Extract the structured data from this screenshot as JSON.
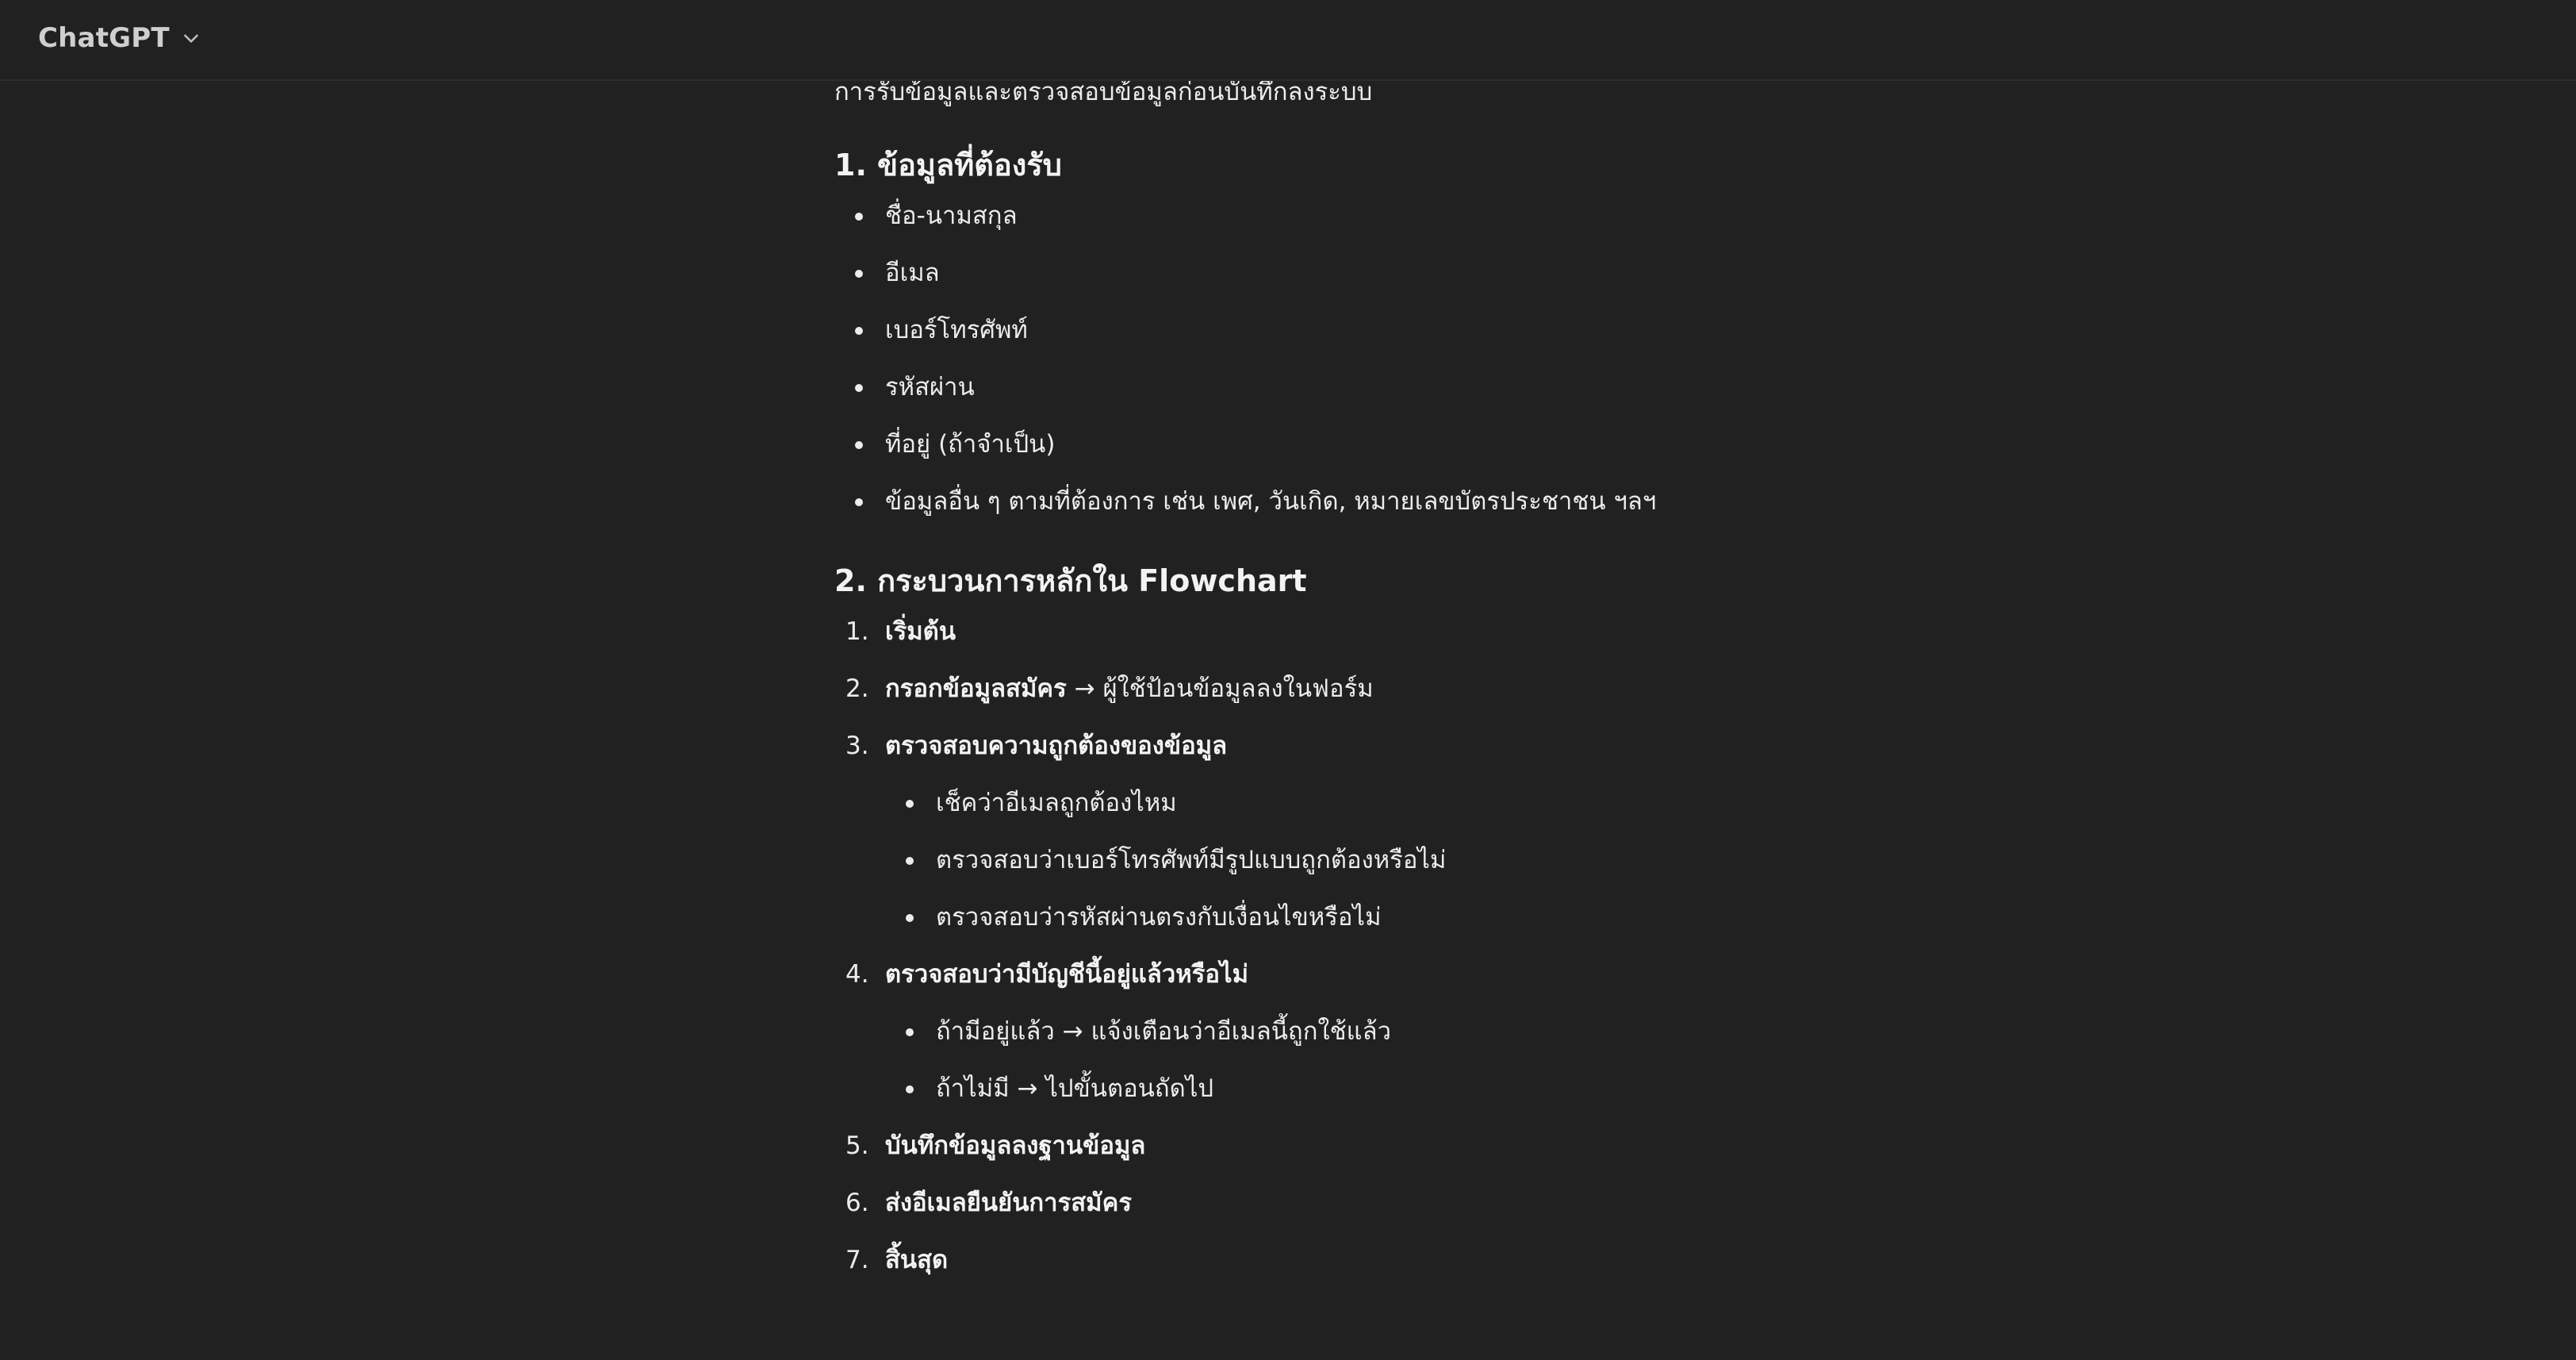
{
  "app": {
    "title": "ChatGPT"
  },
  "message": {
    "intro": "การรับข้อมูลและตรวจสอบข้อมูลก่อนบันทึกลงระบบ",
    "section1": {
      "heading": "1. ข้อมูลที่ต้องรับ",
      "items": [
        "ชื่อ-นามสกุล",
        "อีเมล",
        "เบอร์โทรศัพท์",
        "รหัสผ่าน",
        "ที่อยู่ (ถ้าจำเป็น)",
        "ข้อมูลอื่น ๆ ตามที่ต้องการ เช่น เพศ, วันเกิด, หมายเลขบัตรประชาชน ฯลฯ"
      ]
    },
    "section2": {
      "heading": "2. กระบวนการหลักใน Flowchart",
      "steps": [
        {
          "num": "1.",
          "bold": "เริ่มต้น",
          "rest": ""
        },
        {
          "num": "2.",
          "bold": "กรอกข้อมูลสมัคร",
          "rest": " → ผู้ใช้ป้อนข้อมูลลงในฟอร์ม"
        },
        {
          "num": "3.",
          "bold": "ตรวจสอบความถูกต้องของข้อมูล",
          "rest": "",
          "sub": [
            "เช็คว่าอีเมลถูกต้องไหม",
            "ตรวจสอบว่าเบอร์โทรศัพท์มีรูปแบบถูกต้องหรือไม่",
            "ตรวจสอบว่ารหัสผ่านตรงกับเงื่อนไขหรือไม่"
          ]
        },
        {
          "num": "4.",
          "bold": "ตรวจสอบว่ามีบัญชีนี้อยู่แล้วหรือไม่",
          "rest": "",
          "sub": [
            "ถ้ามีอยู่แล้ว → แจ้งเตือนว่าอีเมลนี้ถูกใช้แล้ว",
            "ถ้าไม่มี → ไปขั้นตอนถัดไป"
          ]
        },
        {
          "num": "5.",
          "bold": "บันทึกข้อมูลลงฐานข้อมูล",
          "rest": ""
        },
        {
          "num": "6.",
          "bold": "ส่งอีเมลยืนยันการสมัคร",
          "rest": ""
        },
        {
          "num": "7.",
          "bold": "สิ้นสุด",
          "rest": ""
        }
      ]
    }
  }
}
